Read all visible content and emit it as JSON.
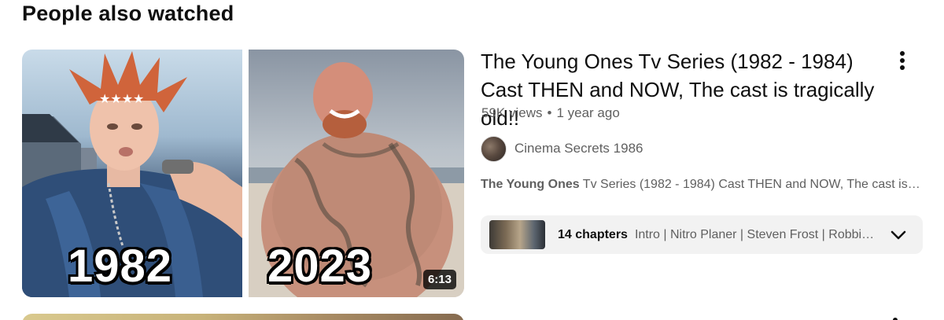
{
  "section": {
    "title": "People also watched"
  },
  "video": {
    "thumbnail": {
      "left_year": "1982",
      "right_year": "2023",
      "duration": "6:13"
    },
    "title": "The Young Ones Tv Series (1982 - 1984) Cast THEN and NOW, The cast is tragically old!!",
    "views": "59K views",
    "separator": "•",
    "age": "1 year ago",
    "channel": "Cinema Secrets 1986",
    "snippet_bold": "The Young Ones",
    "snippet_rest": " Tv Series (1982 - 1984) Cast THEN and NOW, The cast is tragically old!!",
    "chapters": {
      "count_label": "14 chapters",
      "list": "Intro | Nitro Planer | Steven Frost | Robbie Coltrane"
    },
    "icons": {
      "menu": "more-vert-icon",
      "chevron": "chevron-down-icon"
    }
  },
  "colors": {
    "text_primary": "#0f0f0f",
    "text_secondary": "#606060",
    "chapter_bg": "#f2f2f2",
    "duration_bg": "#000000"
  }
}
